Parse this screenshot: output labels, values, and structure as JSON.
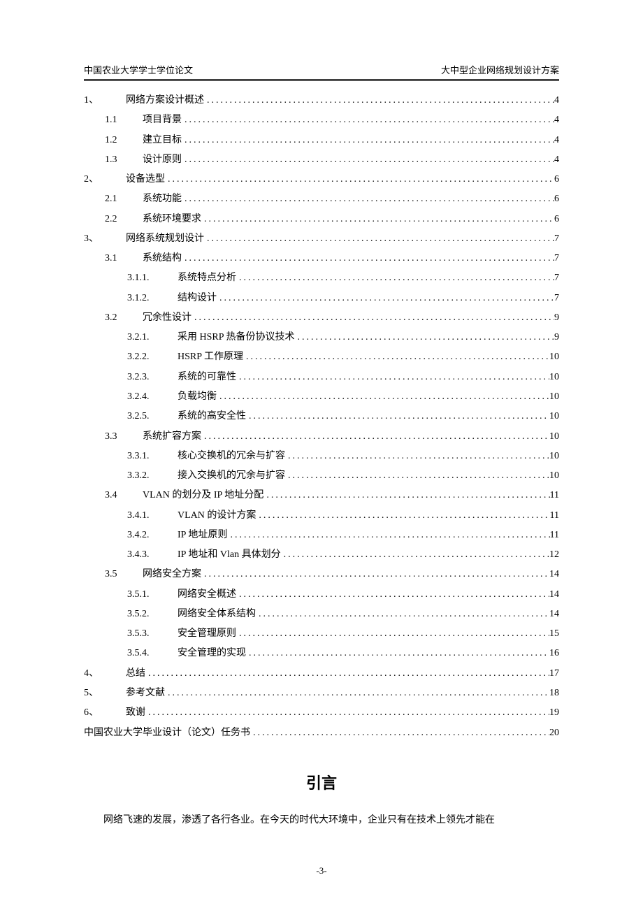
{
  "header": {
    "left": "中国农业大学学士学位论文",
    "right": "大中型企业网络规划设计方案"
  },
  "toc": [
    {
      "level": 0,
      "num": "1、",
      "title": "网络方案设计概述",
      "page": "4"
    },
    {
      "level": 1,
      "num": "1.1",
      "title": "项目背景",
      "page": "4"
    },
    {
      "level": 1,
      "num": "1.2",
      "title": "建立目标",
      "page": "4"
    },
    {
      "level": 1,
      "num": "1.3",
      "title": "设计原则",
      "page": "4"
    },
    {
      "level": 0,
      "num": "2、",
      "title": "设备选型",
      "page": "6"
    },
    {
      "level": 1,
      "num": "2.1",
      "title": "系统功能",
      "page": "6"
    },
    {
      "level": 1,
      "num": "2.2",
      "title": "系统环境要求",
      "page": "6"
    },
    {
      "level": 0,
      "num": "3、",
      "title": "网络系统规划设计",
      "page": "7"
    },
    {
      "level": 1,
      "num": "3.1",
      "title": "系统结构",
      "page": "7"
    },
    {
      "level": 2,
      "num": "3.1.1.",
      "title": "系统特点分析",
      "page": "7"
    },
    {
      "level": 2,
      "num": "3.1.2.",
      "title": "结构设计",
      "page": "7"
    },
    {
      "level": 1,
      "num": "3.2",
      "title": "冗余性设计",
      "page": "9"
    },
    {
      "level": 2,
      "num": "3.2.1.",
      "title": "采用 HSRP 热备份协议技术",
      "page": "9"
    },
    {
      "level": 2,
      "num": "3.2.2.",
      "title": "HSRP 工作原理",
      "page": "10"
    },
    {
      "level": 2,
      "num": "3.2.3.",
      "title": "系统的可靠性",
      "page": "10"
    },
    {
      "level": 2,
      "num": "3.2.4.",
      "title": "负载均衡",
      "page": "10"
    },
    {
      "level": 2,
      "num": "3.2.5.",
      "title": "系统的高安全性",
      "page": "10"
    },
    {
      "level": 1,
      "num": "3.3",
      "title": "系统扩容方案",
      "page": "10"
    },
    {
      "level": 2,
      "num": "3.3.1.",
      "title": "核心交换机的冗余与扩容",
      "page": "10"
    },
    {
      "level": 2,
      "num": "3.3.2.",
      "title": "接入交换机的冗余与扩容",
      "page": "10"
    },
    {
      "level": 1,
      "num": "3.4",
      "title": "VLAN 的划分及 IP 地址分配",
      "page": "11"
    },
    {
      "level": 2,
      "num": "3.4.1.",
      "title": "VLAN 的设计方案",
      "page": "11"
    },
    {
      "level": 2,
      "num": "3.4.2.",
      "title": "IP 地址原则",
      "page": "11"
    },
    {
      "level": 2,
      "num": "3.4.3.",
      "title": "IP 地址和 Vlan 具体划分",
      "page": "12"
    },
    {
      "level": 1,
      "num": "3.5",
      "title": "网络安全方案",
      "page": "14"
    },
    {
      "level": 2,
      "num": "3.5.1.",
      "title": "网络安全概述",
      "page": "14"
    },
    {
      "level": 2,
      "num": "3.5.2.",
      "title": "网络安全体系结构",
      "page": "14"
    },
    {
      "level": 2,
      "num": "3.5.3.",
      "title": "安全管理原则",
      "page": "15"
    },
    {
      "level": 2,
      "num": "3.5.4.",
      "title": "安全管理的实现",
      "page": "16"
    },
    {
      "level": 0,
      "num": "4、",
      "title": "总结",
      "page": "17"
    },
    {
      "level": 0,
      "num": "5、",
      "title": "参考文献",
      "page": "18"
    },
    {
      "level": 0,
      "num": "6、",
      "title": "致谢",
      "page": "19"
    },
    {
      "level": -1,
      "num": "",
      "title": "中国农业大学毕业设计（论文）任务书",
      "page": "20"
    }
  ],
  "intro": {
    "heading": "引言",
    "para1": "网络飞速的发展，渗透了各行各业。在今天的时代大环境中，企业只有在技术上领先才能在"
  },
  "footer": {
    "page": "-3-"
  }
}
